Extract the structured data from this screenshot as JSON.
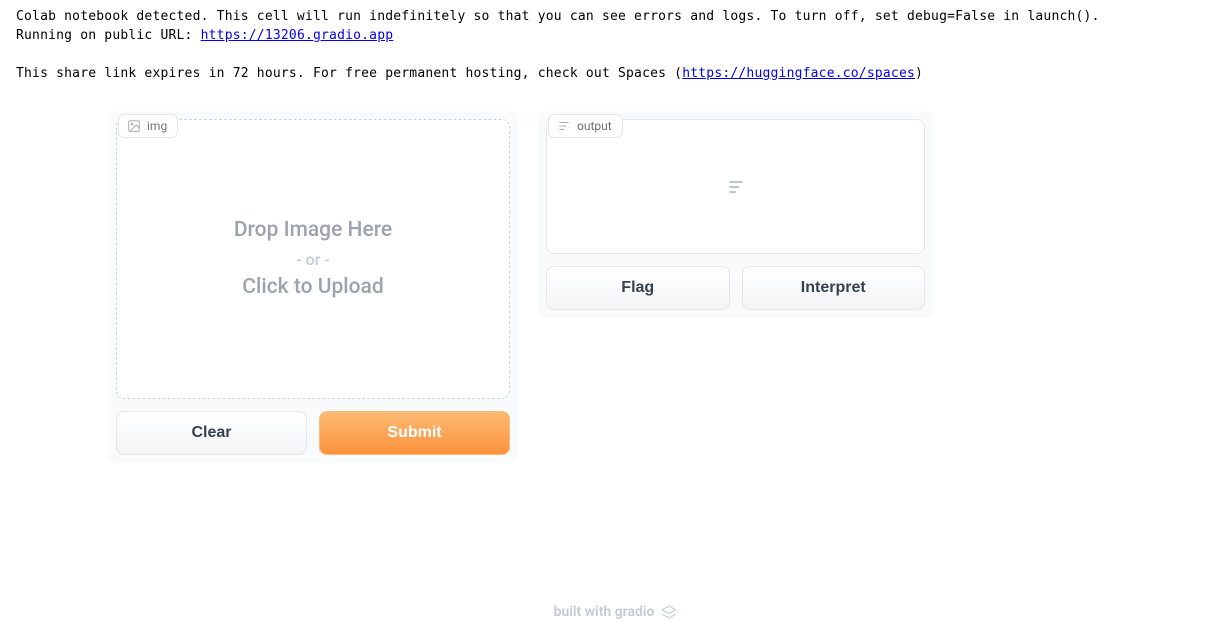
{
  "console": {
    "line1": "Colab notebook detected. This cell will run indefinitely so that you can see errors and logs. To turn off, set debug=False in launch().",
    "line2_prefix": "Running on public URL: ",
    "line2_url": "https://13206.gradio.app",
    "line3_prefix": "This share link expires in 72 hours. For free permanent hosting, check out Spaces (",
    "line3_url": "https://huggingface.co/spaces",
    "line3_suffix": ")"
  },
  "input": {
    "label": "img",
    "drop_text": "Drop Image Here",
    "or_text": "- or -",
    "click_text": "Click to Upload"
  },
  "output": {
    "label": "output"
  },
  "buttons": {
    "clear": "Clear",
    "submit": "Submit",
    "flag": "Flag",
    "interpret": "Interpret"
  },
  "footer": {
    "text": "built with gradio"
  }
}
